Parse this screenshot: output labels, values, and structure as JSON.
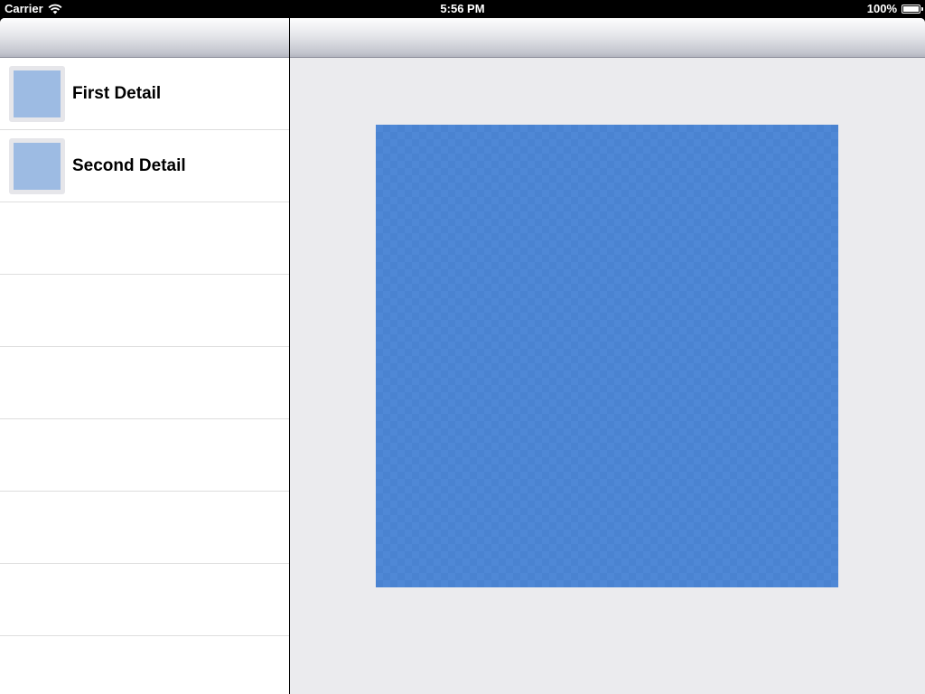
{
  "status_bar": {
    "carrier": "Carrier",
    "time": "5:56 PM",
    "battery": "100%",
    "battery_level": 1.0
  },
  "master": {
    "rows": [
      {
        "label": "First Detail",
        "icon": "thumbnail-image"
      },
      {
        "label": "Second Detail",
        "icon": "thumbnail-image"
      },
      {
        "label": ""
      },
      {
        "label": ""
      },
      {
        "label": ""
      },
      {
        "label": ""
      },
      {
        "label": ""
      },
      {
        "label": ""
      },
      {
        "label": ""
      }
    ]
  },
  "colors": {
    "detail_background": "#ebebee",
    "image_blue": "#4f88d6",
    "thumbnail_blue": "#9dbbe3"
  }
}
